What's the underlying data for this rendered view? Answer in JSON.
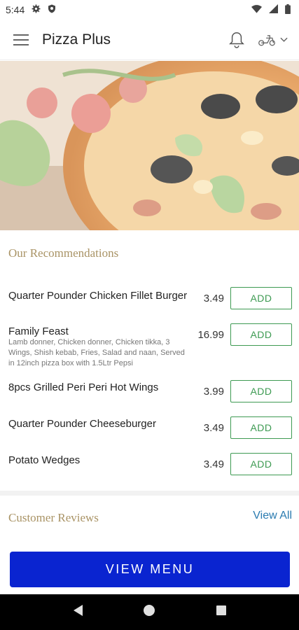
{
  "status_bar": {
    "time": "5:44"
  },
  "app_bar": {
    "title": "Pizza Plus"
  },
  "recommendations": {
    "title": "Our Recommendations",
    "items": [
      {
        "name": "Quarter Pounder Chicken Fillet Burger",
        "description": "",
        "price": "3.49",
        "action": "ADD"
      },
      {
        "name": "Family Feast",
        "description": "Lamb donner, Chicken donner, Chicken tikka, 3 Wings, Shish kebab, Fries, Salad and naan, Served in 12inch pizza box with 1.5Ltr Pepsi",
        "price": "16.99",
        "action": "ADD"
      },
      {
        "name": "8pcs Grilled Peri Peri Hot Wings",
        "description": "",
        "price": "3.99",
        "action": "ADD"
      },
      {
        "name": "Quarter Pounder Cheeseburger",
        "description": "",
        "price": "3.49",
        "action": "ADD"
      },
      {
        "name": "Potato Wedges",
        "description": "",
        "price": "3.49",
        "action": "ADD"
      }
    ]
  },
  "reviews": {
    "title": "Customer Reviews",
    "view_all": "View All"
  },
  "view_menu": {
    "label": "VIEW MENU"
  },
  "colors": {
    "accent_gold": "#a99365",
    "add_green": "#3d9a52",
    "primary_blue": "#0a24d0",
    "link_blue": "#2a7bb0"
  }
}
